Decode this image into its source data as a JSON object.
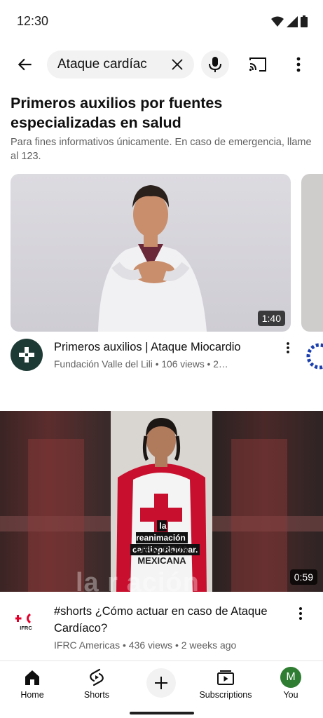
{
  "status_bar": {
    "time": "12:30"
  },
  "search": {
    "query": "Ataque cardíac"
  },
  "health_section": {
    "title": "Primeros auxilios por fuentes especializadas en salud",
    "subtitle": "Para fines informativos únicamente. En caso de emergencia, llame al 123."
  },
  "videos": [
    {
      "title": "Primeros auxilios | Ataque Miocardio",
      "meta": "Fundación Valle del Lili • 106 views • 2…",
      "duration": "1:40"
    },
    {
      "title": "#shorts ¿Cómo actuar en caso de Ataque Cardíaco?",
      "meta": "IFRC Americas • 436 views • 2 weeks ago",
      "duration": "0:59",
      "caption_line1": "la reanimación",
      "caption_line2": "cardiopulmonar.",
      "vest_text": "CRUZ ROJA MEXICANA",
      "overlay_text": "la r   ación",
      "channel_logo_text": "IFRC"
    }
  ],
  "bottom_nav": {
    "home": "Home",
    "shorts": "Shorts",
    "subscriptions": "Subscriptions",
    "you": "You",
    "avatar_letter": "M"
  },
  "colors": {
    "avatar": "#2e7d32",
    "channel1_avatar": "#1e3a34",
    "ifrc_red": "#e4002b"
  }
}
